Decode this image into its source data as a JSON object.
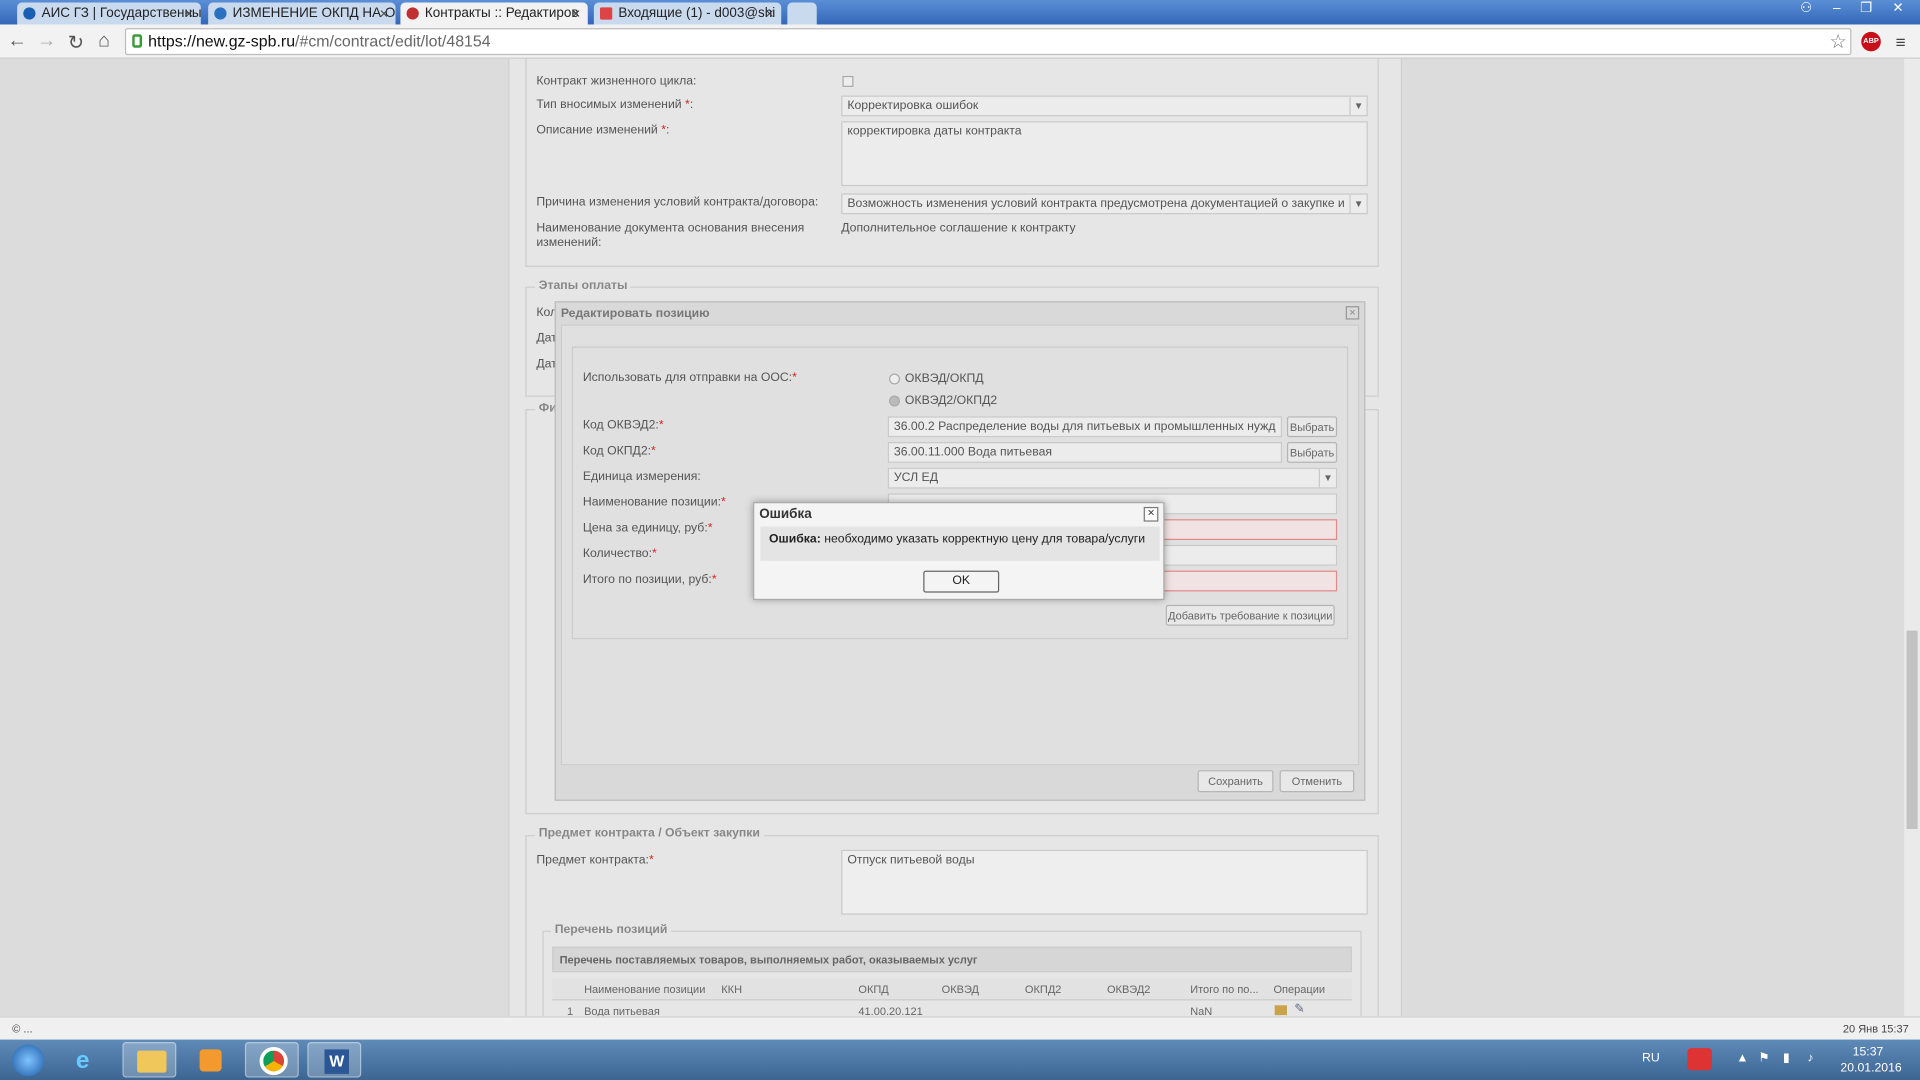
{
  "browser": {
    "tabs": [
      {
        "title": "АИС ГЗ | Государственны",
        "color": "#1a5fb4"
      },
      {
        "title": "ИЗМЕНЕНИЕ ОКПД НА О",
        "color": "#2a6fc0"
      },
      {
        "title": "Контракты :: Редактиров",
        "color": "#c03030"
      },
      {
        "title": "Входящие (1) - d003@shi",
        "color": "#d44"
      }
    ],
    "url_host": "https://new.gz-spb.ru",
    "url_path": "/#cm/contract/edit/lot/48154",
    "abp_label": "ABP"
  },
  "form": {
    "lifecycle_label": "Контракт жизненного цикла:",
    "change_type_label": "Тип вносимых изменений",
    "change_type_value": "Корректировка ошибок",
    "change_desc_label": "Описание изменений",
    "change_desc_value": "корректировка даты контракта",
    "reason_label": "Причина изменения условий контракта/договора:",
    "reason_value": "Возможность изменения условий контракта предусмотрена документацией о закупке и",
    "doc_name_label_1": "Наименование документа основания внесения",
    "doc_name_label_2": "изменений:",
    "doc_name_value": "Дополнительное соглашение к контракту",
    "payments_legend": "Этапы оплаты",
    "row_kol": "Кол",
    "row_dat1": "Дат",
    "row_dat2": "Дат",
    "fi_legend": "Фи"
  },
  "edit_window": {
    "title": "Редактировать позицию",
    "close": "×",
    "send_label": "Использовать для отправки на ООС:",
    "radio1": "ОКВЭД/ОКПД",
    "radio2": "ОКВЭД2/ОКПД2",
    "okved2_label": "Код ОКВЭД2:",
    "okved2_value": "36.00.2 Распределение воды для питьевых и промышленных нужд",
    "okpd2_label": "Код ОКПД2:",
    "okpd2_value": "36.00.11.000 Вода питьевая",
    "choose": "Выбрать",
    "unit_label": "Единица измерения:",
    "unit_value": "УСЛ ЕД",
    "name_label": "Наименование позиции:",
    "price_label": "Цена за единицу, руб:",
    "qty_label": "Количество:",
    "total_label": "Итого по позиции, руб:",
    "add_req": "Добавить требование к позиции",
    "save": "Сохранить",
    "cancel": "Отменить"
  },
  "error_dialog": {
    "title": "Ошибка",
    "close": "×",
    "bold": "Ошибка:",
    "message": " необходимо указать корректную цену для товара/услуги",
    "ok": "OK"
  },
  "subject": {
    "legend": "Предмет контракта / Объект закупки",
    "label": "Предмет контракта:",
    "value": "Отпуск питьевой воды",
    "positions_legend": "Перечень позиций",
    "table_title": "Перечень поставляемых товаров, выполняемых работ, оказываемых услуг",
    "columns": [
      "Наименование позиции",
      "ККН",
      "ОКПД",
      "ОКВЭД",
      "ОКПД2",
      "ОКВЭД2",
      "Итого по по...",
      "Операции"
    ],
    "row": {
      "num": "1",
      "name": "Вода питьевая",
      "okpd": "41.00.20.121",
      "total": "NaN"
    }
  },
  "statusbar": {
    "left": "© ...",
    "right": "20 Янв 15:37"
  },
  "taskbar": {
    "lang": "RU",
    "time": "15:37",
    "date": "20.01.2016"
  }
}
